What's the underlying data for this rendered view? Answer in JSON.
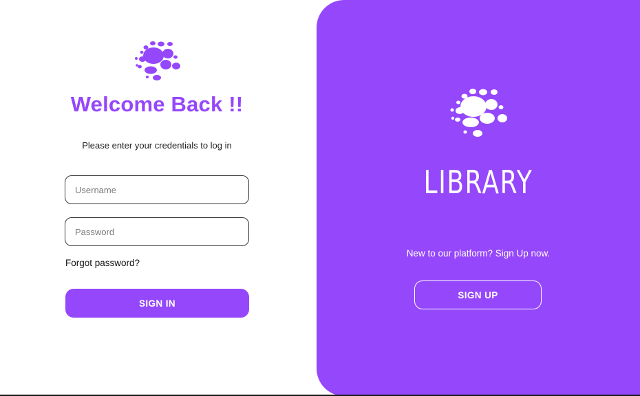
{
  "login": {
    "title": "Welcome Back !!",
    "subtitle": "Please enter your credentials to log in",
    "username_placeholder": "Username",
    "password_placeholder": "Password",
    "forgot_label": "Forgot password?",
    "signin_label": "SIGN IN",
    "logo_icon": "dotted-sphere-icon"
  },
  "panel": {
    "brand": "LIBRARY",
    "prompt": "New to our platform? Sign Up now.",
    "signup_label": "SIGN UP",
    "logo_icon": "dotted-sphere-icon"
  },
  "colors": {
    "accent": "#9547fb",
    "background": "#ffffff",
    "panel_text": "#ffffff"
  }
}
